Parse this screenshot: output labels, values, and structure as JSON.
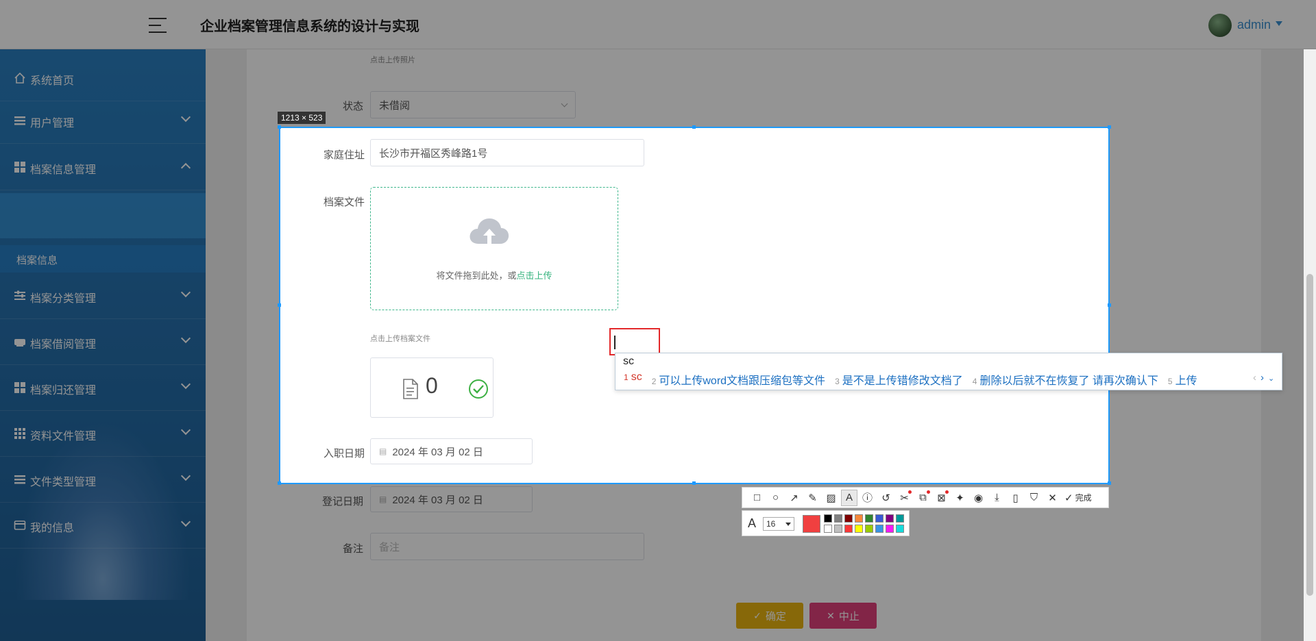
{
  "header": {
    "app_title": "企业档案管理信息系统的设计与实现",
    "user_name": "admin"
  },
  "sidebar": {
    "items": [
      {
        "label": "系统首页",
        "icon": "home-icon"
      },
      {
        "label": "用户管理",
        "icon": "list-icon"
      },
      {
        "label": "档案信息管理",
        "icon": "grid-icon"
      },
      {
        "label": "档案分类管理",
        "icon": "sliders-icon"
      },
      {
        "label": "档案借阅管理",
        "icon": "printer-icon"
      },
      {
        "label": "档案归还管理",
        "icon": "grid-icon"
      },
      {
        "label": "资料文件管理",
        "icon": "apps-icon"
      },
      {
        "label": "文件类型管理",
        "icon": "list-icon"
      },
      {
        "label": "我的信息",
        "icon": "card-icon"
      }
    ],
    "sub_item": "档案信息"
  },
  "form": {
    "photo_hint": "点击上传照片",
    "status_label": "状态",
    "status_value": "未借阅",
    "address_label": "家庭住址",
    "address_value": "长沙市开福区秀峰路1号",
    "file_label": "档案文件",
    "upload_text": "将文件拖到此处，或",
    "upload_link": "点击上传",
    "upload_hint": "点击上传档案文件",
    "file_count": "0",
    "join_label": "入职日期",
    "join_value": "2024 年 03 月 02 日",
    "reg_label": "登记日期",
    "reg_value": "2024 年 03 月 02 日",
    "remark_label": "备注",
    "remark_placeholder": "备注",
    "confirm_label": "确定",
    "cancel_label": "中止"
  },
  "capture": {
    "size_label": "1213 × 523"
  },
  "ime": {
    "input": "sc",
    "candidates": [
      {
        "no": "1",
        "text": "sc"
      },
      {
        "no": "2",
        "text": "可以上传word文档跟压缩包等文件"
      },
      {
        "no": "3",
        "text": "是不是上传错修改文档了"
      },
      {
        "no": "4",
        "text": "删除以后就不在恢复了 请再次确认下"
      },
      {
        "no": "5",
        "text": "上传"
      }
    ]
  },
  "toolbar": {
    "done_label": "完成",
    "font_size": "16",
    "current_color": "#f04040",
    "palette": [
      "#000000",
      "#808080",
      "#800000",
      "#f7883a",
      "#308430",
      "#385ad3",
      "#800080",
      "#009999",
      "#ffffff",
      "#c0c0c0",
      "#fb3838",
      "#ffff00",
      "#99cc00",
      "#3894e4",
      "#f31bf3",
      "#16dcdc"
    ]
  }
}
